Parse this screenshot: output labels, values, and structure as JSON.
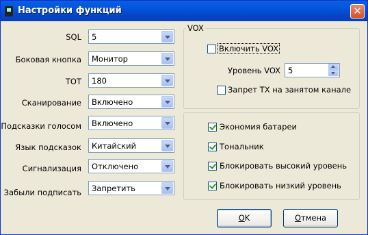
{
  "window": {
    "title": "Настройки функций",
    "close_glyph": "✕"
  },
  "settings": [
    {
      "label": "SQL",
      "value": "5"
    },
    {
      "label": "Боковая кнопка",
      "value": "Монитор"
    },
    {
      "label": "TOT",
      "value": "180"
    },
    {
      "label": "Сканирование",
      "value": "Включено"
    },
    {
      "label": "Подсказки голосом",
      "value": "Включено"
    },
    {
      "label": "Язык подсказок",
      "value": "Китайский"
    },
    {
      "label": "Сигнализация",
      "value": "Отключено"
    },
    {
      "label": "Забыли подписать",
      "value": "Запретить"
    }
  ],
  "vox": {
    "group_title": "VOX",
    "enable_label": "Включить VOX",
    "enable_checked": false,
    "level_label": "Уровень VOX",
    "level_value": "5",
    "block_tx_label": "Запрет TX на занятом канале",
    "block_tx_checked": false
  },
  "options": [
    {
      "label": "Экономия батареи",
      "checked": true
    },
    {
      "label": "Тональник",
      "checked": true
    },
    {
      "label": "Блокировать высокий уровень",
      "checked": true
    },
    {
      "label": "Блокировать низкий уровень",
      "checked": true
    }
  ],
  "buttons": {
    "ok_mnemonic": "O",
    "ok_rest": "K",
    "cancel_mnemonic": "О",
    "cancel_rest": "тмена"
  }
}
